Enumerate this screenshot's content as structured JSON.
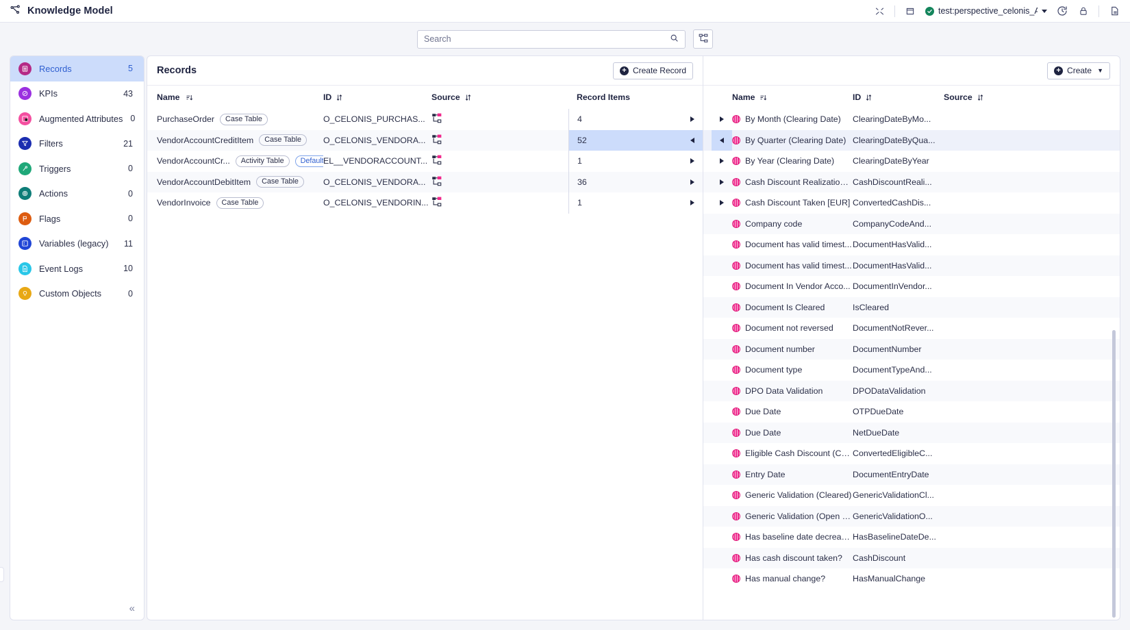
{
  "topbar": {
    "app_title": "Knowledge Model",
    "workspace": "test:perspective_celonis_A...",
    "icons": [
      "shuffle-icon",
      "database-icon",
      "history-icon",
      "lock-icon",
      "export-icon"
    ]
  },
  "search": {
    "placeholder": "Search",
    "value": "",
    "search_icon": "search-icon",
    "diagram_button_icon": "data-model-icon"
  },
  "sidebar": {
    "collapse_label": "«",
    "items": [
      {
        "label": "Records",
        "count": "5",
        "icon": "records-icon",
        "color": "#b52a86",
        "active": true
      },
      {
        "label": "KPIs",
        "count": "43",
        "icon": "kpi-icon",
        "color": "#9b30e0",
        "active": false
      },
      {
        "label": "Augmented Attributes",
        "count": "0",
        "icon": "augmented-icon",
        "color": "#f44fa0",
        "active": false
      },
      {
        "label": "Filters",
        "count": "21",
        "icon": "filter-icon",
        "color": "#1b2db0",
        "active": false
      },
      {
        "label": "Triggers",
        "count": "0",
        "icon": "trigger-icon",
        "color": "#1fa879",
        "active": false
      },
      {
        "label": "Actions",
        "count": "0",
        "icon": "actions-icon",
        "color": "#0e7d78",
        "active": false
      },
      {
        "label": "Flags",
        "count": "0",
        "icon": "flag-icon",
        "color": "#dd5c10",
        "active": false
      },
      {
        "label": "Variables (legacy)",
        "count": "11",
        "icon": "variables-icon",
        "color": "#2046d6",
        "active": false
      },
      {
        "label": "Event Logs",
        "count": "10",
        "icon": "eventlog-icon",
        "color": "#29c7e8",
        "active": false
      },
      {
        "label": "Custom Objects",
        "count": "0",
        "icon": "custom-icon",
        "color": "#e8a815",
        "active": false
      }
    ]
  },
  "records_panel": {
    "title": "Records",
    "create_button": "Create Record",
    "columns": {
      "name": "Name",
      "id": "ID",
      "source": "Source",
      "record_items": "Record Items"
    },
    "rows": [
      {
        "name": "PurchaseOrder",
        "tags": [
          {
            "text": "Case Table",
            "style": "grey"
          }
        ],
        "id": "O_CELONIS_PURCHAS...",
        "source_icon": "table-link-icon",
        "items": "4",
        "selected": false,
        "arrow": "right"
      },
      {
        "name": "VendorAccountCreditItem",
        "tags": [
          {
            "text": "Case Table",
            "style": "grey"
          }
        ],
        "id": "O_CELONIS_VENDORA...",
        "source_icon": "table-link-icon",
        "items": "52",
        "selected": true,
        "arrow": "left"
      },
      {
        "name": "VendorAccountCr...",
        "tags": [
          {
            "text": "Activity Table",
            "style": "grey"
          },
          {
            "text": "Default",
            "style": "blue"
          }
        ],
        "id": "EL__VENDORACCOUNT...",
        "source_icon": "table-link-icon",
        "items": "1",
        "selected": false,
        "arrow": "right"
      },
      {
        "name": "VendorAccountDebitItem",
        "tags": [
          {
            "text": "Case Table",
            "style": "grey"
          }
        ],
        "id": "O_CELONIS_VENDORA...",
        "source_icon": "table-link-icon",
        "items": "36",
        "selected": false,
        "arrow": "right"
      },
      {
        "name": "VendorInvoice",
        "tags": [
          {
            "text": "Case Table",
            "style": "grey"
          }
        ],
        "id": "O_CELONIS_VENDORIN...",
        "source_icon": "table-link-icon",
        "items": "1",
        "selected": false,
        "arrow": "right"
      }
    ]
  },
  "detail_panel": {
    "create_button": "Create",
    "columns": {
      "name": "Name",
      "id": "ID",
      "source": "Source"
    },
    "rows": [
      {
        "name": "By Month (Clearing Date)",
        "id": "ClearingDateByMo...",
        "arrow": "right",
        "selected": false
      },
      {
        "name": "By Quarter (Clearing Date)",
        "id": "ClearingDateByQua...",
        "arrow": "left",
        "selected": true
      },
      {
        "name": "By Year (Clearing Date)",
        "id": "ClearingDateByYear",
        "arrow": "right",
        "selected": false
      },
      {
        "name": "Cash Discount Realization ...",
        "id": "CashDiscountReali...",
        "arrow": "right",
        "selected": false
      },
      {
        "name": "Cash Discount Taken [EUR]",
        "id": "ConvertedCashDis...",
        "arrow": "right",
        "selected": false
      },
      {
        "name": "Company code",
        "id": "CompanyCodeAnd...",
        "arrow": "",
        "selected": false
      },
      {
        "name": "Document has valid timest...",
        "id": "DocumentHasValid...",
        "arrow": "",
        "selected": false
      },
      {
        "name": "Document has valid timest...",
        "id": "DocumentHasValid...",
        "arrow": "",
        "selected": false
      },
      {
        "name": "Document In Vendor Acco...",
        "id": "DocumentInVendor...",
        "arrow": "",
        "selected": false
      },
      {
        "name": "Document Is Cleared",
        "id": "IsCleared",
        "arrow": "",
        "selected": false
      },
      {
        "name": "Document not reversed",
        "id": "DocumentNotRever...",
        "arrow": "",
        "selected": false
      },
      {
        "name": "Document number",
        "id": "DocumentNumber",
        "arrow": "",
        "selected": false
      },
      {
        "name": "Document type",
        "id": "DocumentTypeAnd...",
        "arrow": "",
        "selected": false
      },
      {
        "name": "DPO Data Validation",
        "id": "DPODataValidation",
        "arrow": "",
        "selected": false
      },
      {
        "name": "Due Date",
        "id": "OTPDueDate",
        "arrow": "",
        "selected": false
      },
      {
        "name": "Due Date",
        "id": "NetDueDate",
        "arrow": "",
        "selected": false
      },
      {
        "name": "Eligible Cash Discount (Co...",
        "id": "ConvertedEligibleC...",
        "arrow": "",
        "selected": false
      },
      {
        "name": "Entry Date",
        "id": "DocumentEntryDate",
        "arrow": "",
        "selected": false
      },
      {
        "name": "Generic Validation (Cleared)",
        "id": "GenericValidationCl...",
        "arrow": "",
        "selected": false
      },
      {
        "name": "Generic Validation (Open &...",
        "id": "GenericValidationO...",
        "arrow": "",
        "selected": false
      },
      {
        "name": "Has baseline date decrease?",
        "id": "HasBaselineDateDe...",
        "arrow": "",
        "selected": false
      },
      {
        "name": "Has cash discount taken?",
        "id": "CashDiscount",
        "arrow": "",
        "selected": false
      },
      {
        "name": "Has manual change?",
        "id": "HasManualChange",
        "arrow": "",
        "selected": false
      }
    ]
  },
  "colors": {
    "accent_blue": "#2f5fd0",
    "selection": "#ccdcfb",
    "pink": "#f0288c",
    "page_bg": "#f4f5f9"
  }
}
